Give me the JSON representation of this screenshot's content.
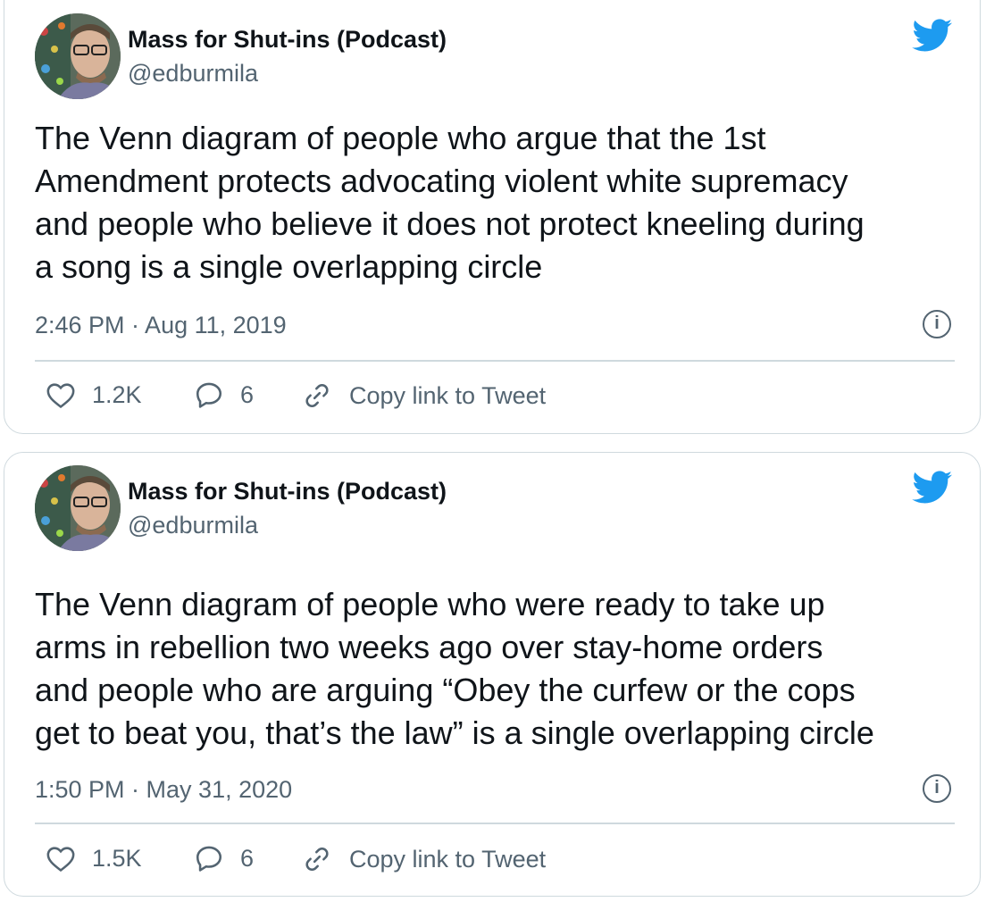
{
  "brand": {
    "twitter_blue": "#1d9bf0",
    "secondary_text": "#536471",
    "border": "#cfd9de"
  },
  "tweets": [
    {
      "display_name": "Mass for Shut-ins (Podcast)",
      "handle": "@edburmila",
      "text": "The Venn diagram of people who argue that the 1st\nAmendment protects advocating violent white supremacy\nand people who believe it does not protect kneeling during\na song is a single overlapping circle",
      "timestamp": "2:46 PM · Aug 11, 2019",
      "likes": "1.2K",
      "replies": "6",
      "copy_link_label": "Copy link to Tweet"
    },
    {
      "display_name": "Mass for Shut-ins (Podcast)",
      "handle": "@edburmila",
      "text": "The Venn diagram of people who were ready to take up\narms in rebellion two weeks ago over stay-home orders\nand people who are arguing “Obey the curfew or the cops\nget to beat you, that’s the law” is a single overlapping circle",
      "timestamp": "1:50 PM · May 31, 2020",
      "likes": "1.5K",
      "replies": "6",
      "copy_link_label": "Copy link to Tweet"
    }
  ],
  "icons": [
    "twitter-bird-icon",
    "info-icon",
    "heart-icon",
    "reply-icon",
    "link-icon"
  ]
}
